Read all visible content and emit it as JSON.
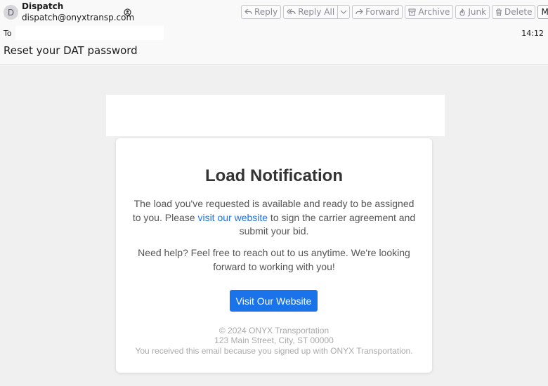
{
  "header": {
    "avatar_letter": "D",
    "sender_name": "Dispatch",
    "sender_email": "dispatch@onyxtransp.com",
    "to_label": "To",
    "time": "14:12",
    "subject": "Reset your DAT password"
  },
  "toolbar": {
    "reply": "Reply",
    "reply_all": "Reply All",
    "forward": "Forward",
    "archive": "Archive",
    "junk": "Junk",
    "delete": "Delete",
    "more": "More"
  },
  "email": {
    "title": "Load Notification",
    "para1_before": "The load you've requested is available and ready to be assigned to you. Please ",
    "para1_link": "visit our website",
    "para1_after": " to sign the carrier agreement and submit your bid.",
    "para2": "Need help? Feel free to reach out to us anytime. We're looking forward to working with you!",
    "cta": "Visit Our Website",
    "footer_copyright": "© 2024 ONYX Transportation",
    "footer_address": "123 Main Street, City, ST 00000",
    "footer_notice": "You received this email because you signed up with ONYX Transportation."
  },
  "colors": {
    "accent": "#1a73e8",
    "body_background": "#f0f0f0"
  }
}
